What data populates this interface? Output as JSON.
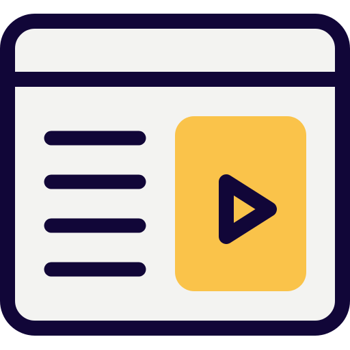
{
  "icon": {
    "name": "web-video-page-icon",
    "colors": {
      "outline": "#110638",
      "window_fill": "#f3f3f1",
      "video_fill": "#fac34a"
    }
  }
}
